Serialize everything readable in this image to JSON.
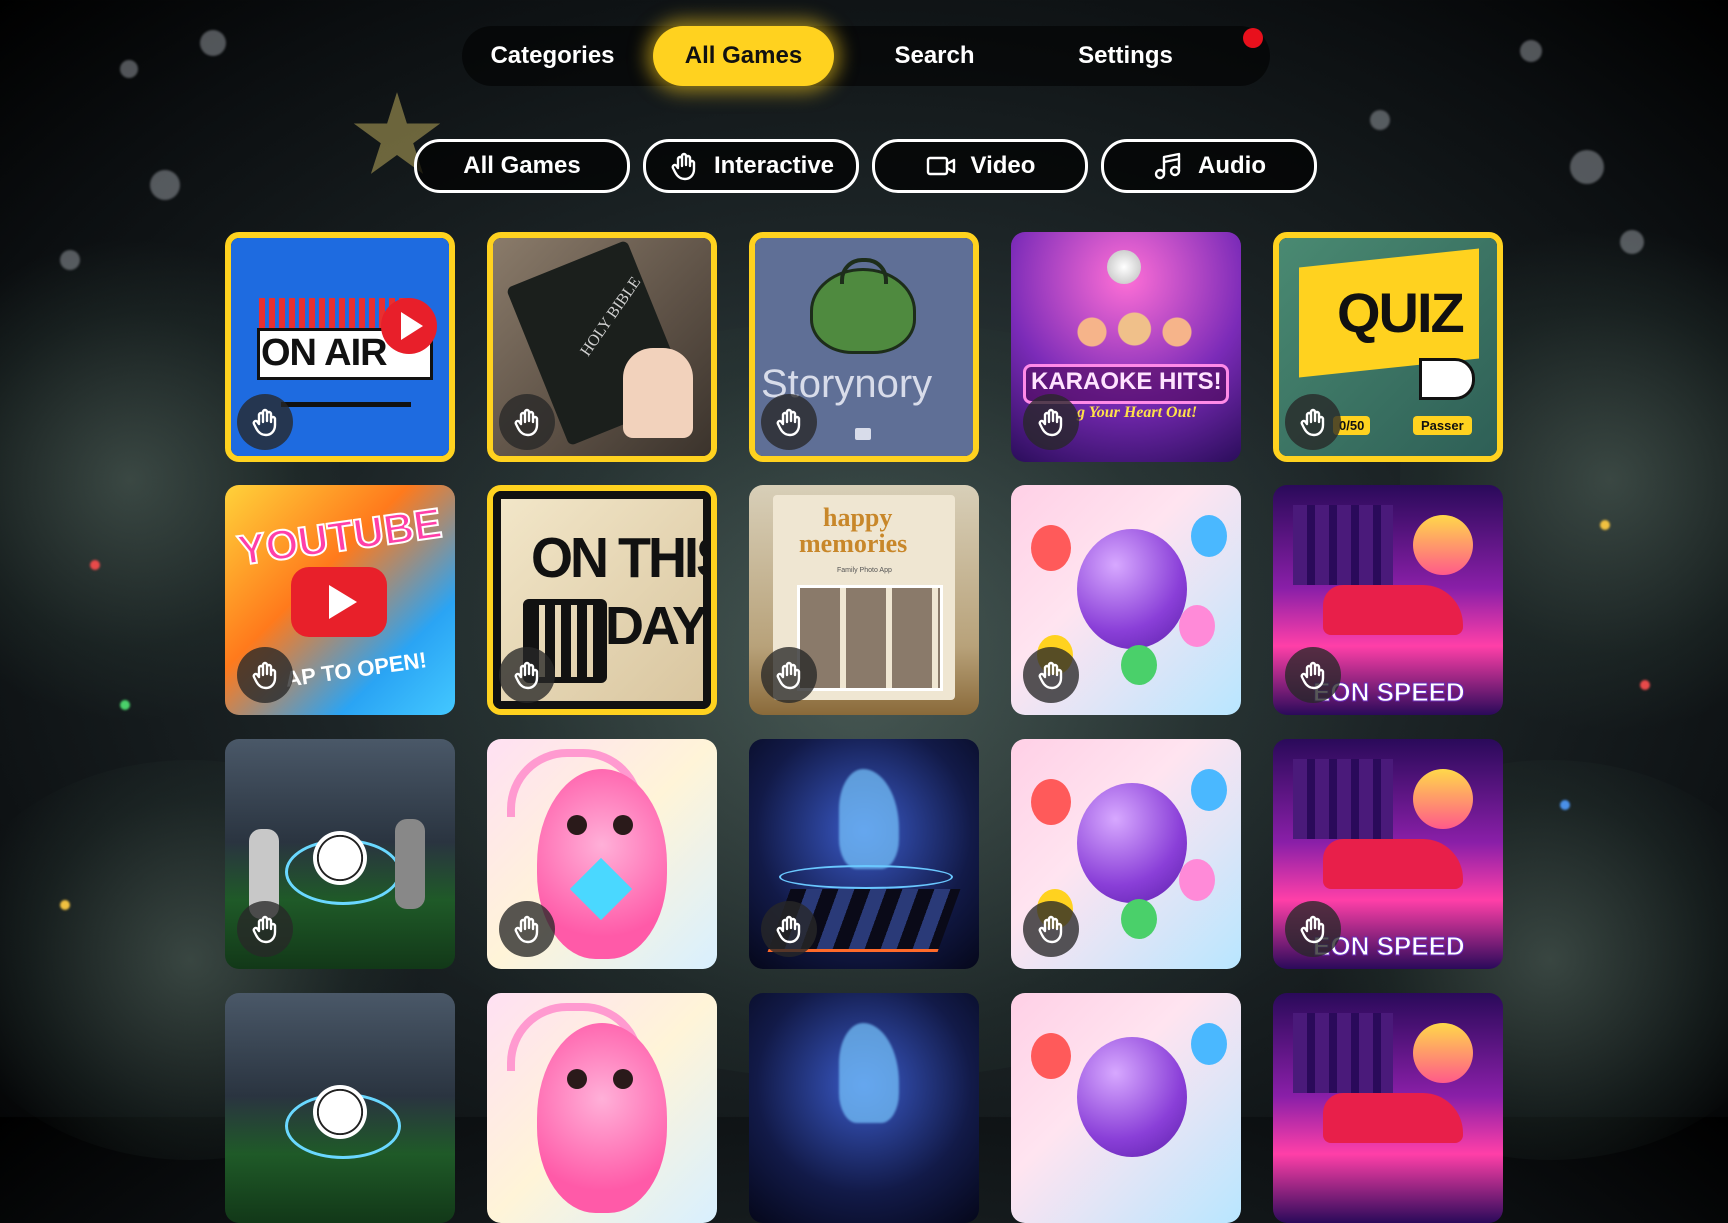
{
  "top_nav": {
    "items": [
      {
        "label": "Categories",
        "active": false
      },
      {
        "label": "All Games",
        "active": true
      },
      {
        "label": "Search",
        "active": false
      },
      {
        "label": "Settings",
        "active": false
      }
    ],
    "has_notification": true
  },
  "filters": [
    {
      "label": "All Games",
      "icon": "none"
    },
    {
      "label": "Interactive",
      "icon": "hand-icon"
    },
    {
      "label": "Video",
      "icon": "video-icon"
    },
    {
      "label": "Audio",
      "icon": "music-note-icon"
    }
  ],
  "colors": {
    "accent": "#ffd21f",
    "notification": "#e8101c"
  },
  "tiles": {
    "onair": {
      "text": "ON AIR"
    },
    "bible": {
      "text": "HOLY BIBLE"
    },
    "storynory": {
      "text": "Storynory"
    },
    "karaoke": {
      "title": "KARAOKE HITS!",
      "subtitle": "g Your Heart Out!"
    },
    "quiz": {
      "title": "QUIZ",
      "score": "0/50",
      "skip": "Passer"
    },
    "youtube": {
      "title": "YOUTUBE",
      "subtitle": "AP TO OPEN!"
    },
    "onthisday": {
      "line1": "ON THIS",
      "line2": "DAY"
    },
    "memories": {
      "line1": "happy",
      "line2": "memories",
      "caption": "Family Photo App"
    },
    "neon": {
      "text": "EON SPEED"
    }
  }
}
